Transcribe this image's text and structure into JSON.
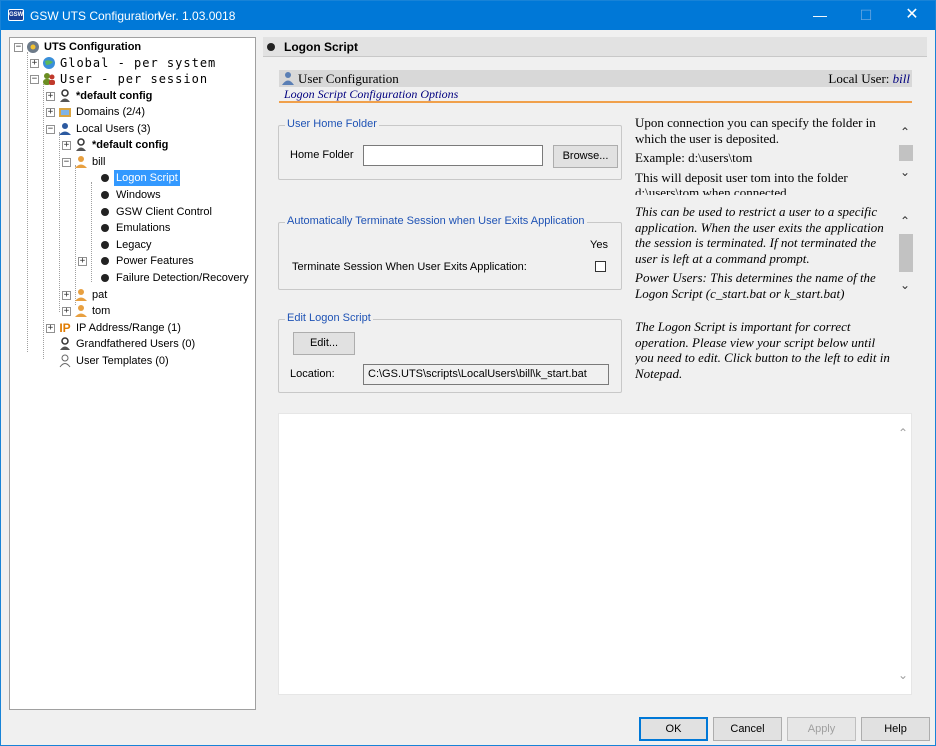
{
  "window": {
    "app_icon_text": "GSW",
    "title": "GSW UTS Configuration",
    "version": "Ver. 1.03.0018",
    "controls": {
      "minimize": "—",
      "maximize": "☐",
      "close": "✕"
    }
  },
  "tree": {
    "root": "UTS Configuration",
    "global": "Global - per system",
    "user": "User - per session",
    "default_config": "*default config",
    "domains": "Domains (2/4)",
    "local_users": "Local Users (3)",
    "local_default_config": "*default config",
    "bill": "bill",
    "logon_script": "Logon Script",
    "windows": "Windows",
    "gsw_client_control": "GSW Client Control",
    "emulations": "Emulations",
    "legacy": "Legacy",
    "power_features": "Power Features",
    "failure_detection": "Failure Detection/Recovery",
    "pat": "pat",
    "tom": "tom",
    "ip_address": "IP Address/Range (1)",
    "ip_icon": "IP",
    "grandfathered_users": "Grandfathered Users (0)",
    "user_templates": "User Templates (0)"
  },
  "header": {
    "title": "Logon Script"
  },
  "user_config": {
    "title": "User Configuration",
    "local_user_label": "Local User:",
    "local_user_name": "bill",
    "subtitle": "Logon Script Configuration Options"
  },
  "home_folder": {
    "group_title": "User Home Folder",
    "label": "Home Folder",
    "value": "",
    "browse_label": "Browse..."
  },
  "home_folder_help": {
    "line1": "Upon connection you can specify the folder in which the user is deposited.",
    "line2": "Example: d:\\users\\tom",
    "line3": "This will deposit user tom into the folder d:\\users\\tom when connected"
  },
  "terminate": {
    "group_title": "Automatically Terminate Session when User Exits Application",
    "yes_label": "Yes",
    "label": "Terminate Session When User Exits Application:",
    "checked": false
  },
  "terminate_help": {
    "line1": "This can be used to restrict a user to a specific application. When the user exits the application the session is terminated. If not terminated the user is left at a command prompt.",
    "line2": "Power Users: This determines the name of the Logon Script (c_start.bat or k_start.bat)"
  },
  "edit_script": {
    "group_title": "Edit Logon Script",
    "edit_label": "Edit...",
    "location_label": "Location:",
    "location_value": "C:\\GS.UTS\\scripts\\LocalUsers\\bill\\k_start.bat"
  },
  "edit_help": {
    "text": "The Logon Script is important for correct operation. Please view your script below until you need to edit. Click button to the left to edit in Notepad."
  },
  "script_content": "",
  "buttons": {
    "ok": "OK",
    "cancel": "Cancel",
    "apply": "Apply",
    "help": "Help"
  },
  "glyphs": {
    "collapse": "−",
    "expand": "+",
    "up": "⌃",
    "down": "⌄"
  }
}
